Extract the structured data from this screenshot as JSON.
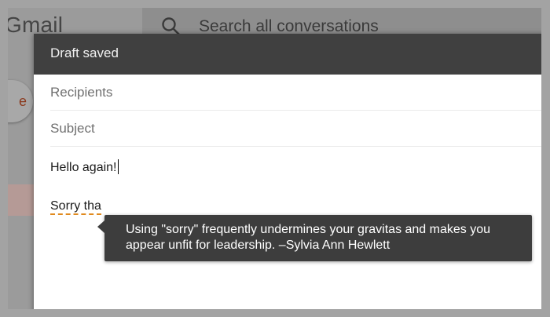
{
  "app": {
    "logo_text": "Gmail"
  },
  "search": {
    "placeholder": "Search all conversations",
    "icon": "search-icon"
  },
  "compose_fab": {
    "partial_label": "e"
  },
  "compose": {
    "title": "Draft saved",
    "recipients_placeholder": "Recipients",
    "subject_placeholder": "Subject",
    "body": {
      "line1": "Hello again!",
      "line2_visible": "Sorry tha"
    },
    "flagged_word": "Sorry"
  },
  "tooltip": {
    "text": "Using \"sorry\" frequently undermines your gravitas and makes you appear unfit for leadership. –Sylvia Ann Hewlett"
  },
  "colors": {
    "header_bg": "#404040",
    "tooltip_bg": "#3d3d3d",
    "flag_underline": "#e08a1e",
    "overlay": "#9b9b9b"
  }
}
